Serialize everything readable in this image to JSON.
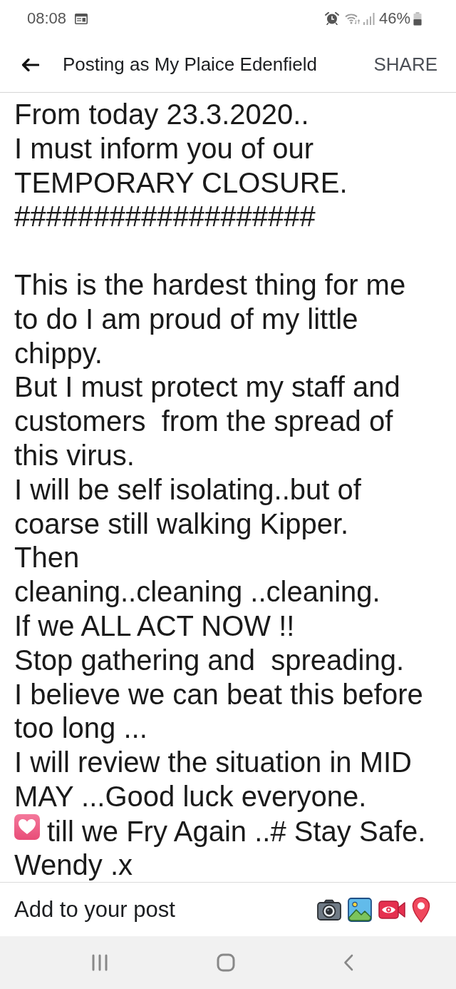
{
  "status_bar": {
    "time": "08:08",
    "battery": "46%"
  },
  "header": {
    "title": "Posting as My Plaice Edenfield",
    "action": "SHARE"
  },
  "post_field": {
    "lines": [
      {
        "kind": "text",
        "text": "From today 23.3.2020.."
      },
      {
        "kind": "text",
        "text": "I must inform you of our"
      },
      {
        "kind": "text",
        "text": "TEMPORARY CLOSURE."
      },
      {
        "kind": "text",
        "text": "###################"
      },
      {
        "kind": "blank"
      },
      {
        "kind": "text",
        "text": "This is the hardest thing for me"
      },
      {
        "kind": "text",
        "text": "to do I am proud of my little"
      },
      {
        "kind": "text",
        "text": "chippy."
      },
      {
        "kind": "text",
        "text": "But I must protect my staff and"
      },
      {
        "kind": "text",
        "text": "customers  from the spread of"
      },
      {
        "kind": "text",
        "text": "this virus."
      },
      {
        "kind": "text",
        "text": "I will be self isolating..but of"
      },
      {
        "kind": "text",
        "text": "coarse still walking Kipper."
      },
      {
        "kind": "text",
        "text": "Then"
      },
      {
        "kind": "text",
        "text": "cleaning..cleaning ..cleaning."
      },
      {
        "kind": "text",
        "text": "If we ALL ACT NOW !!"
      },
      {
        "kind": "text",
        "text": "Stop gathering and  spreading."
      },
      {
        "kind": "text",
        "text": "I believe we can beat this before"
      },
      {
        "kind": "text",
        "text": "too long ..."
      },
      {
        "kind": "text",
        "text": "I will review the situation in MID"
      },
      {
        "kind": "text",
        "text": "MAY ...Good luck everyone."
      },
      {
        "kind": "emoji",
        "text": "till we Fry Again ..# Stay Safe."
      },
      {
        "kind": "text",
        "text": "Wendy .x"
      }
    ]
  },
  "composer_bar": {
    "label": "Add to your post"
  }
}
